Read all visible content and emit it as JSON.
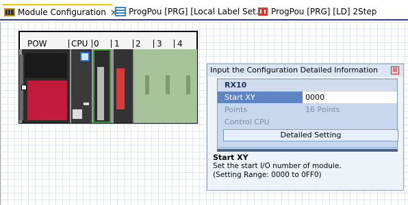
{
  "tabs": [
    {
      "label": "Module Configuration",
      "active": true,
      "icon": "module-config-icon"
    },
    {
      "label": "ProgPou [PRG] [Local Label Set...",
      "active": false,
      "icon": "label-table-icon"
    },
    {
      "label": "ProgPou [PRG] [LD] 2Step",
      "active": false,
      "icon": "ladder-icon"
    }
  ],
  "close_glyph": "×",
  "base": {
    "slot_labels": [
      "POW",
      "CPU",
      "0",
      "1",
      "2",
      "3",
      "4"
    ]
  },
  "dialog": {
    "title": "Input the Configuration Detailed Information",
    "close_glyph": "⊠",
    "module_name": "RX10",
    "rows": [
      {
        "key": "Start XY",
        "value": "0000"
      },
      {
        "key": "Points",
        "value": "16 Points"
      },
      {
        "key": "Control CPU",
        "value": ""
      }
    ],
    "detail_button": "Detailed Setting",
    "help": {
      "title": "Start XY",
      "line1": "Set the start I/O number of module.",
      "line2": "(Setting Range: 0000 to 0FF0)"
    }
  },
  "colors": {
    "tab_accent": "#f2c200",
    "pow_red": "#c21b3b",
    "cpu_blue": "#1f6fd0",
    "module_green": "#a6c49a",
    "selected_row": "#5f84c4"
  }
}
